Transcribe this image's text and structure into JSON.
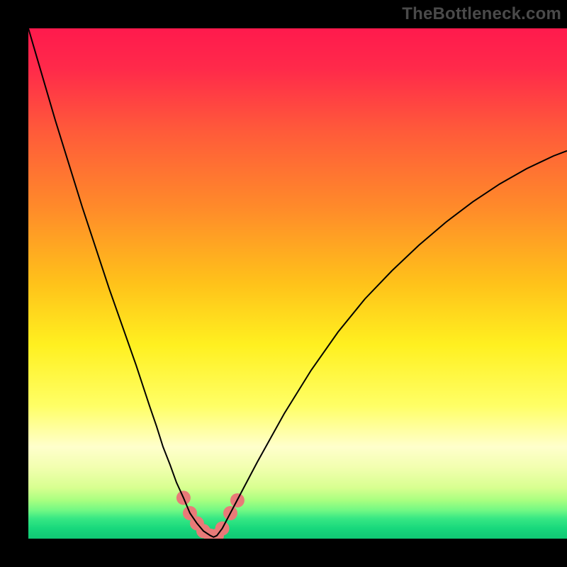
{
  "watermark": "TheBottleneck.com",
  "chart_data": {
    "type": "line",
    "title": "",
    "xlabel": "",
    "ylabel": "",
    "xlim": [
      0,
      100
    ],
    "ylim": [
      0,
      100
    ],
    "grid": false,
    "legend": false,
    "background_gradient": {
      "stops": [
        {
          "offset": 0.0,
          "color": "#ff1a4d"
        },
        {
          "offset": 0.08,
          "color": "#ff2a4a"
        },
        {
          "offset": 0.2,
          "color": "#ff5a3a"
        },
        {
          "offset": 0.35,
          "color": "#ff8a2a"
        },
        {
          "offset": 0.5,
          "color": "#ffc21a"
        },
        {
          "offset": 0.62,
          "color": "#fff020"
        },
        {
          "offset": 0.74,
          "color": "#ffff66"
        },
        {
          "offset": 0.82,
          "color": "#ffffcc"
        },
        {
          "offset": 0.86,
          "color": "#f2ffb0"
        },
        {
          "offset": 0.9,
          "color": "#d8ff90"
        },
        {
          "offset": 0.925,
          "color": "#a8ff80"
        },
        {
          "offset": 0.945,
          "color": "#70f884"
        },
        {
          "offset": 0.96,
          "color": "#38e884"
        },
        {
          "offset": 0.98,
          "color": "#18d87c"
        },
        {
          "offset": 1.0,
          "color": "#10c874"
        }
      ]
    },
    "series": [
      {
        "name": "curve",
        "color": "#000000",
        "width": 2,
        "x": [
          0.0,
          2.5,
          5.0,
          7.5,
          10.0,
          12.5,
          15.0,
          17.5,
          20.0,
          22.5,
          23.8,
          25.0,
          26.3,
          27.5,
          28.8,
          30.0,
          31.3,
          32.5,
          33.8,
          34.4,
          35.0,
          36.0,
          37.5,
          40.0,
          42.5,
          47.5,
          52.5,
          57.5,
          62.5,
          67.5,
          72.5,
          77.5,
          82.5,
          87.5,
          92.5,
          97.5,
          100.0
        ],
        "y": [
          100.0,
          91.0,
          82.0,
          73.5,
          65.0,
          57.0,
          49.0,
          41.5,
          34.0,
          26.0,
          22.0,
          18.0,
          14.5,
          11.0,
          8.0,
          5.0,
          3.0,
          1.5,
          0.6,
          0.3,
          0.6,
          2.0,
          5.0,
          10.0,
          15.0,
          24.5,
          33.0,
          40.5,
          47.0,
          52.5,
          57.5,
          62.0,
          66.0,
          69.5,
          72.5,
          75.0,
          76.0
        ]
      }
    ],
    "markers": {
      "name": "valley-markers",
      "color": "#e97a78",
      "radius_px": 10,
      "points": [
        {
          "x": 28.8,
          "y": 8.0
        },
        {
          "x": 30.0,
          "y": 5.0
        },
        {
          "x": 31.3,
          "y": 3.0
        },
        {
          "x": 32.5,
          "y": 1.5
        },
        {
          "x": 33.8,
          "y": 0.6
        },
        {
          "x": 34.4,
          "y": 0.3
        },
        {
          "x": 35.0,
          "y": 0.6
        },
        {
          "x": 36.0,
          "y": 2.0
        },
        {
          "x": 37.5,
          "y": 5.0
        },
        {
          "x": 38.8,
          "y": 7.5
        }
      ]
    }
  }
}
